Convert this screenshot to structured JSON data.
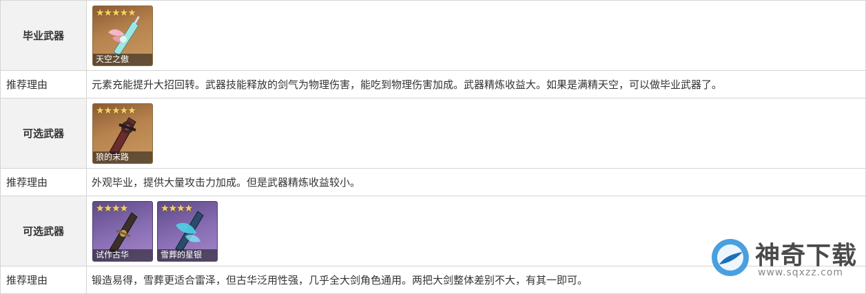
{
  "rows": [
    {
      "label": "毕业武器",
      "weapons": [
        {
          "name": "天空之傲",
          "stars": "★★★★★",
          "rarity": "5",
          "icon": "greatsword-icon"
        }
      ]
    },
    {
      "reason_label": "推荐理由",
      "text": "元素充能提升大招回转。武器技能释放的剑气为物理伤害，能吃到物理伤害加成。武器精炼收益大。如果是满精天空，可以做毕业武器了。"
    },
    {
      "label": "可选武器",
      "weapons": [
        {
          "name": "狼的末路",
          "stars": "★★★★★",
          "rarity": "5",
          "icon": "greatsword-icon"
        }
      ]
    },
    {
      "reason_label": "推荐理由",
      "text": "外观毕业，提供大量攻击力加成。但是武器精炼收益较小。"
    },
    {
      "label": "可选武器",
      "weapons": [
        {
          "name": "试作古华",
          "stars": "★★★★",
          "rarity": "4",
          "icon": "greatsword-icon"
        },
        {
          "name": "雪葬的星银",
          "stars": "★★★★",
          "rarity": "4",
          "icon": "greatsword-icon"
        }
      ]
    },
    {
      "reason_label": "推荐理由",
      "text": "锻造易得，雪葬更适合雷泽，但古华泛用性强，几乎全大剑角色通用。两把大剑整体差别不大，有其一即可。"
    }
  ],
  "watermark": {
    "title": "神奇下载",
    "url": "www.sqxzz.com"
  },
  "colors": {
    "five_star_bg": "#b8834e",
    "four_star_bg": "#8a6fb6",
    "star": "#f5d36a",
    "label_bg": "#f2f2f2",
    "border": "#d4d4d4"
  }
}
